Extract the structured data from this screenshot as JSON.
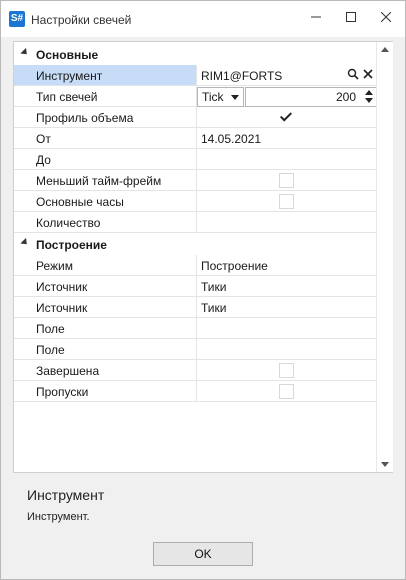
{
  "window": {
    "title": "Настройки свечей",
    "app_icon_label": "S#"
  },
  "grid": {
    "categories": {
      "basic": "Основные",
      "build": "Построение"
    },
    "props": {
      "instrument": {
        "label": "Инструмент",
        "value": "RIM1@FORTS"
      },
      "candle_type": {
        "label": "Тип свечей",
        "combo_value": "Tick",
        "number_value": "200"
      },
      "volume_profile": {
        "label": "Профиль объема",
        "checked": true
      },
      "from": {
        "label": "От",
        "value": "14.05.2021"
      },
      "to": {
        "label": "До",
        "value": ""
      },
      "smaller_timeframe": {
        "label": "Меньший тайм-фрейм",
        "checked": false
      },
      "regular_hours": {
        "label": "Основные часы",
        "checked": false
      },
      "count": {
        "label": "Количество",
        "value": ""
      },
      "mode": {
        "label": "Режим",
        "value": "Построение"
      },
      "source1": {
        "label": "Источник",
        "value": "Тики"
      },
      "source2": {
        "label": "Источник",
        "value": "Тики"
      },
      "field1": {
        "label": "Поле",
        "value": ""
      },
      "field2": {
        "label": "Поле",
        "value": ""
      },
      "finished": {
        "label": "Завершена",
        "checked": false
      },
      "gaps": {
        "label": "Пропуски",
        "checked": false
      }
    }
  },
  "description": {
    "title": "Инструмент",
    "text": "Инструмент."
  },
  "buttons": {
    "ok": "OK"
  },
  "icons": {
    "minimize": "minimize-icon",
    "maximize": "maximize-icon",
    "close": "close-icon",
    "search": "search-icon",
    "clear": "clear-icon"
  },
  "colors": {
    "selection": "#c6dcf7",
    "app_icon": "#1976d2"
  }
}
